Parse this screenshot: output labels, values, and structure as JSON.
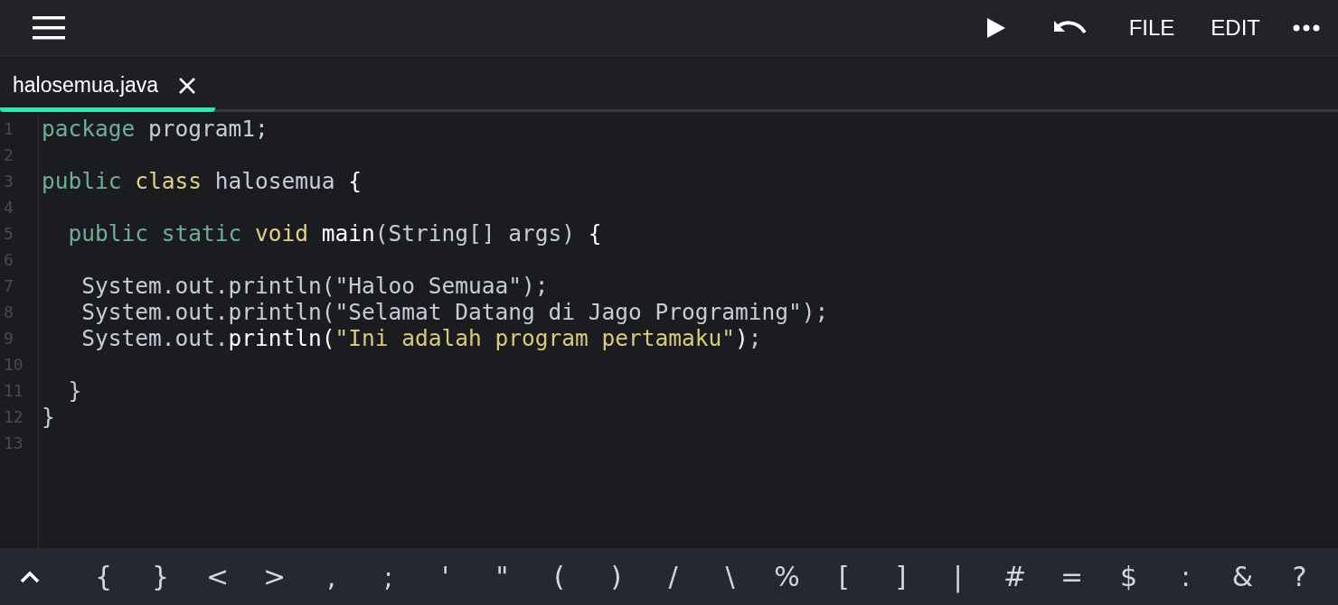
{
  "toolbar": {
    "actions": [
      "FILE",
      "EDIT"
    ]
  },
  "tabs": [
    {
      "label": "halosemua.java",
      "selected": true
    }
  ],
  "code": [
    {
      "number": "1",
      "tokens": [
        {
          "kind": "keyword",
          "text": "package"
        },
        {
          "kind": "plain",
          "text": " program1;"
        }
      ]
    },
    {
      "number": "2"
    },
    {
      "number": "3",
      "tokens": [
        {
          "kind": "keyword",
          "text": "public"
        },
        {
          "kind": "type",
          "text": " class"
        },
        {
          "kind": "plain",
          "text": " halosemua "
        },
        {
          "kind": "bright",
          "text": "{"
        }
      ]
    },
    {
      "number": "4"
    },
    {
      "number": "5",
      "tokens": [
        {
          "kind": "keyword",
          "text": "  public static"
        },
        {
          "kind": "type",
          "text": " void"
        },
        {
          "kind": "bright",
          "text": " main"
        },
        {
          "kind": "plain",
          "text": "(String[] args) "
        },
        {
          "kind": "bright",
          "text": "{"
        }
      ]
    },
    {
      "number": "6"
    },
    {
      "number": "7",
      "tokens": [
        {
          "kind": "plain",
          "text": "   System.out.println(\"Haloo Semuaa\");"
        }
      ]
    },
    {
      "number": "8",
      "tokens": [
        {
          "kind": "plain",
          "text": "   System.out.println(\"Selamat Datang di Jago Programing\");"
        }
      ]
    },
    {
      "number": "9",
      "tokens": [
        {
          "kind": "plain",
          "text": "   System.out."
        },
        {
          "kind": "bright",
          "text": "println("
        },
        {
          "kind": "string",
          "text": "\"Ini adalah program pertamaku\""
        },
        {
          "kind": "bright",
          "text": ")"
        },
        {
          "kind": "plain",
          "text": ";"
        }
      ]
    },
    {
      "number": "10"
    },
    {
      "number": "11",
      "tokens": [
        {
          "kind": "plain",
          "text": "  }"
        }
      ]
    },
    {
      "number": "12",
      "tokens": [
        {
          "kind": "plain",
          "text": "}"
        }
      ]
    },
    {
      "number": "13"
    }
  ],
  "symbol_keys": [
    "{",
    "}",
    "<",
    ">",
    ",",
    ";",
    "'",
    "\"",
    "(",
    ")",
    "/",
    "\\",
    "%",
    "[",
    "]",
    "|",
    "#",
    "=",
    "$",
    ":",
    "&",
    "?"
  ]
}
